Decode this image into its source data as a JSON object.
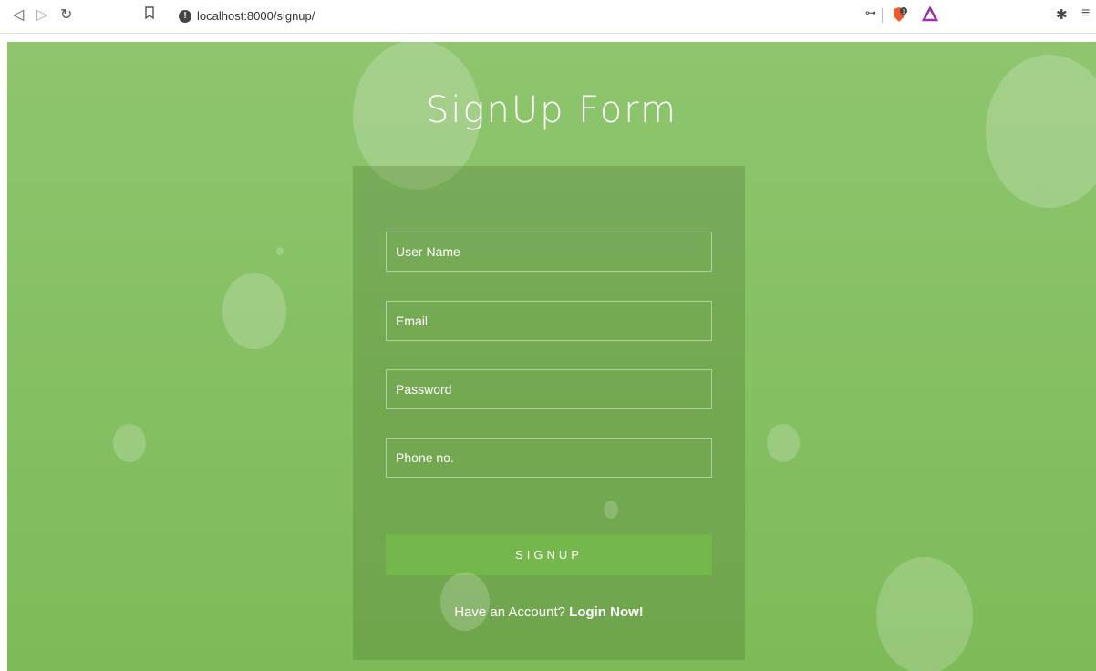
{
  "browser": {
    "url": "localhost:8000/signup/",
    "icons": [
      "back-icon",
      "forward-icon",
      "reload-icon",
      "bookmark-icon",
      "info-icon",
      "key-icon",
      "brave-shield-icon",
      "brave-rewards-icon",
      "extensions-icon",
      "menu-icon"
    ],
    "shield_badge": "1"
  },
  "page": {
    "title": "SignUp Form",
    "fields": {
      "username_placeholder": "User Name",
      "email_placeholder": "Email",
      "password_placeholder": "Password",
      "phone_placeholder": "Phone no."
    },
    "signup_label": "SIGNUP",
    "account_prompt": "Have an Account?",
    "login_link": "Login Now!"
  },
  "colors": {
    "background": "#8ec56e",
    "card": "#6a9a50",
    "button": "#74b84b",
    "text": "#ffffff"
  }
}
